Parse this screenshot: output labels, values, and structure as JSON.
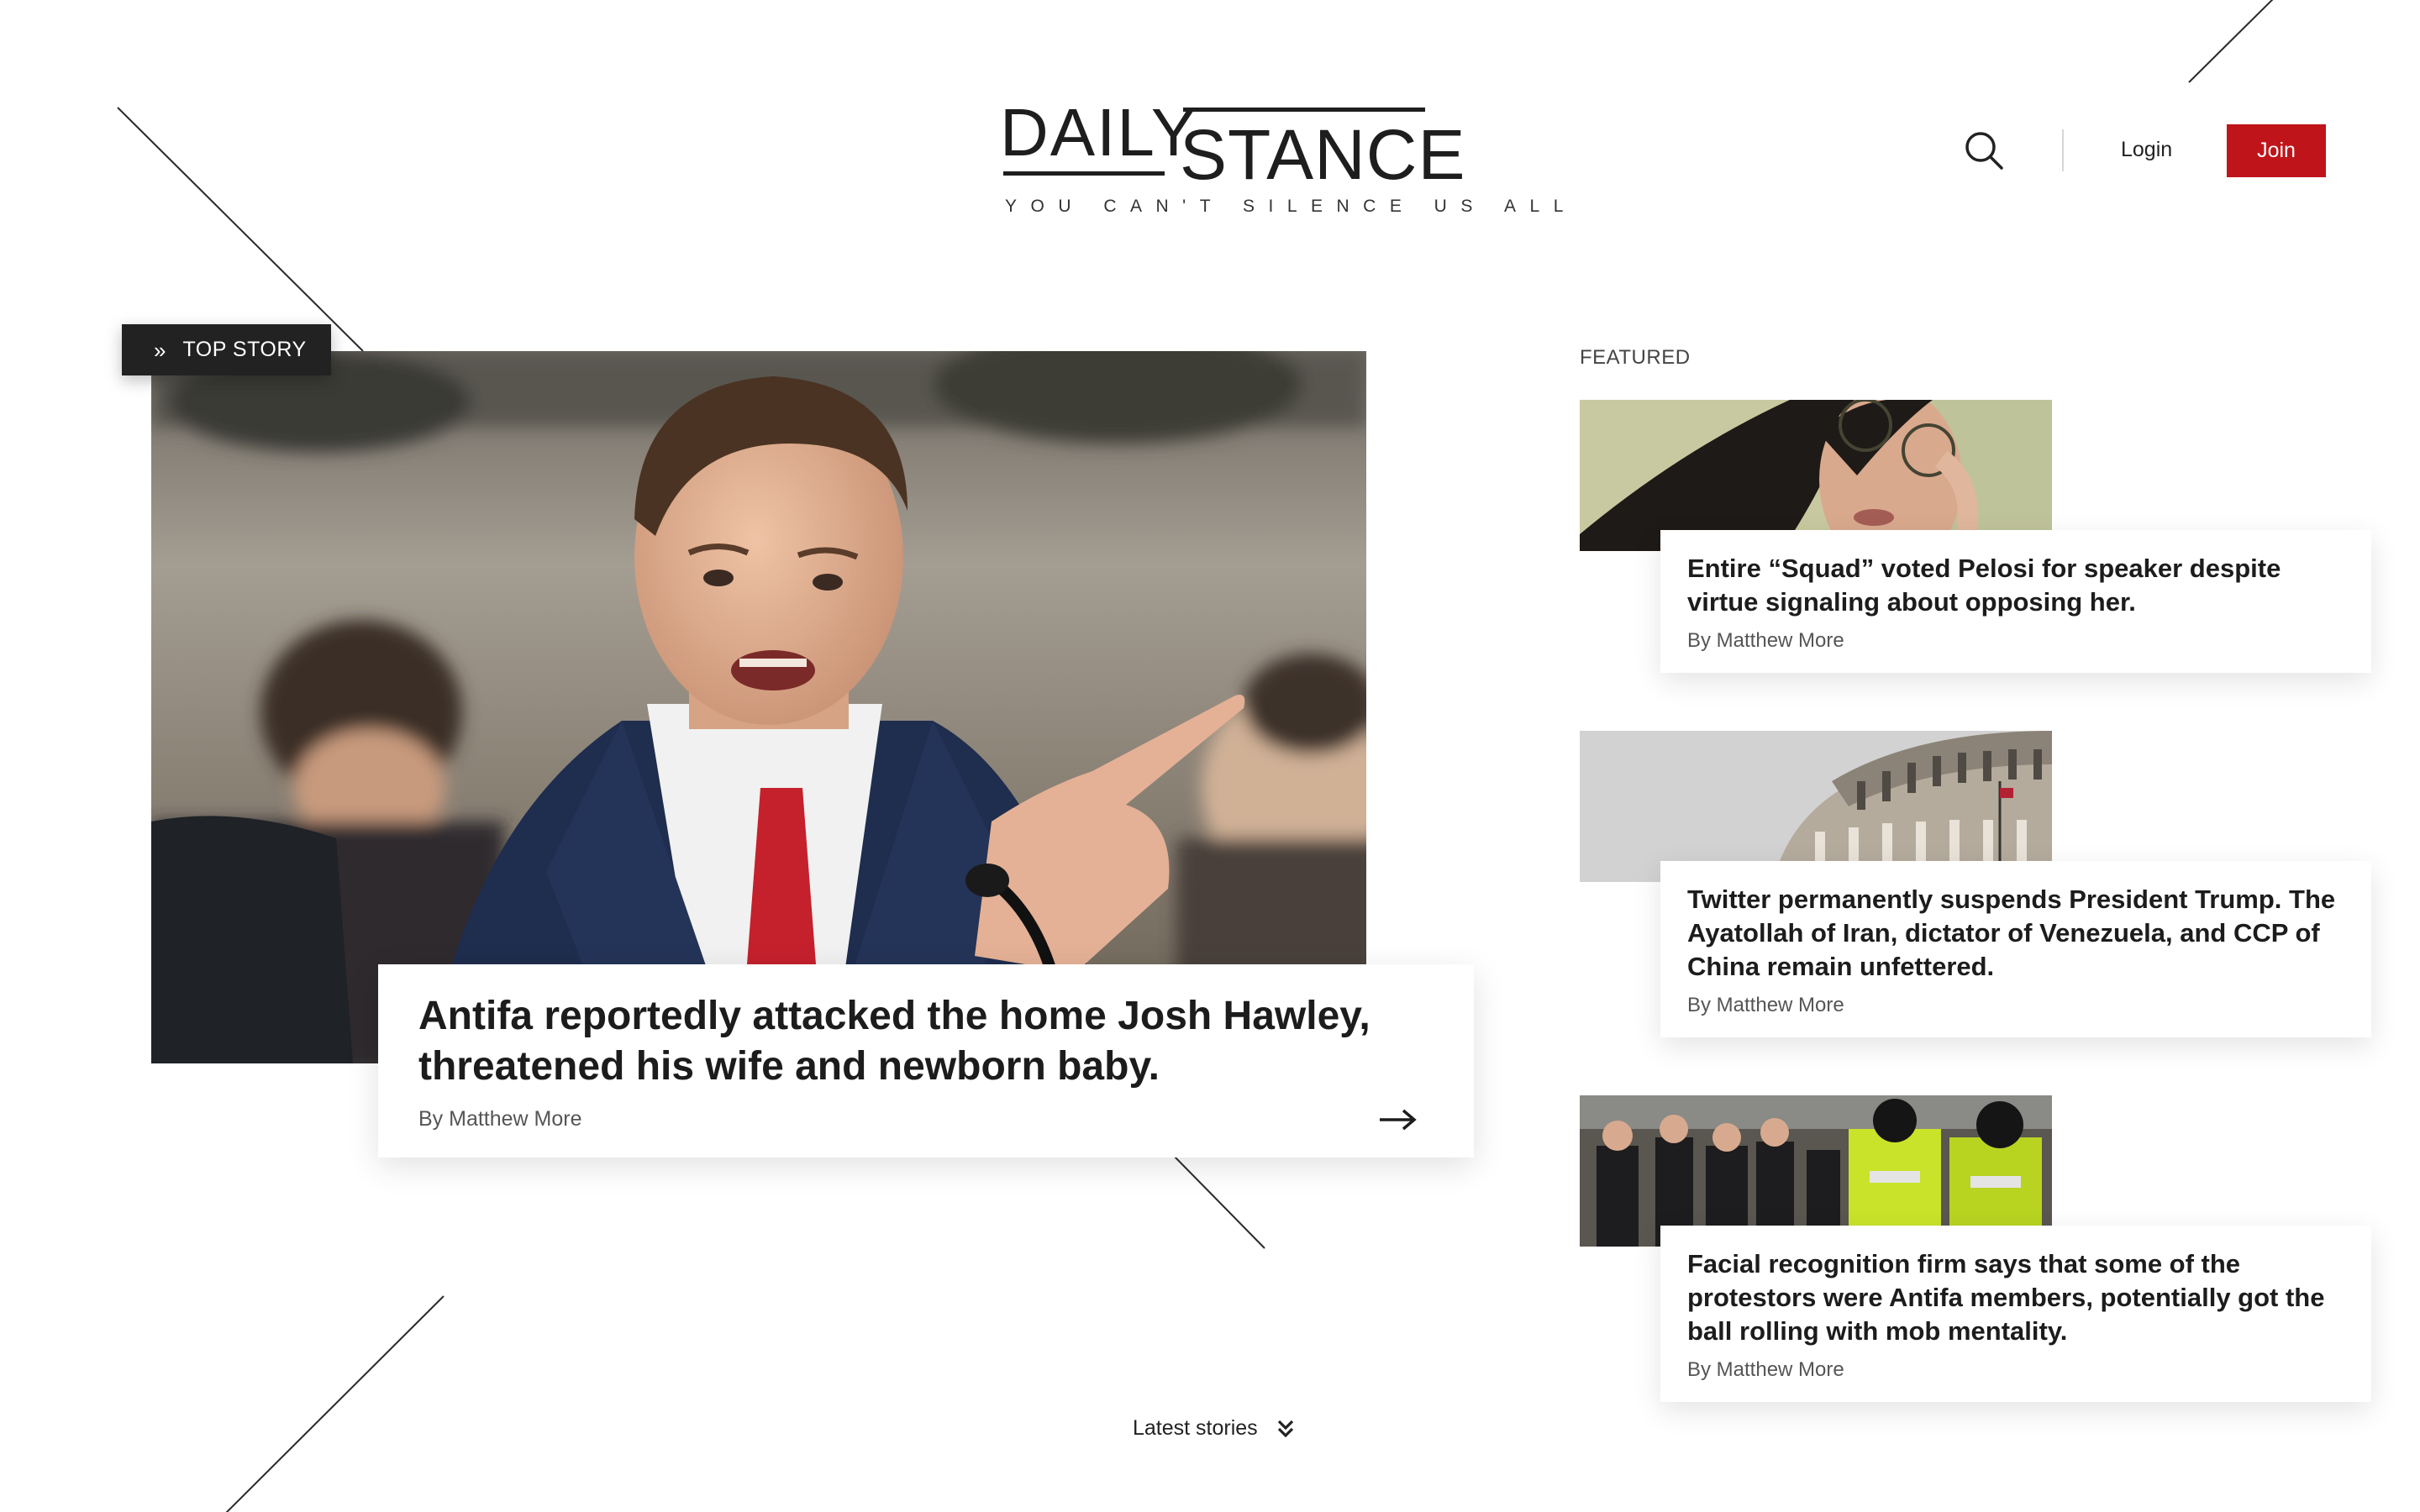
{
  "brand": {
    "name_line1": "DAILY",
    "name_line2": "STANCE",
    "tagline": "YOU CAN'T SILENCE US ALL"
  },
  "header": {
    "search_icon": "search-icon",
    "login_label": "Login",
    "join_label": "Join",
    "join_color": "#c0141b"
  },
  "top_story": {
    "badge_icon": "double-chevron-right-icon",
    "badge_label": "TOP STORY",
    "image": "photo of a man in a suit pointing at a hearing",
    "headline": "Antifa reportedly attacked the home Josh Hawley, threatened his wife and newborn baby.",
    "byline": "By Matthew More",
    "arrow_icon": "arrow-right-icon"
  },
  "featured": {
    "section_label": "FEATURED",
    "items": [
      {
        "image": "photo of a woman with glasses",
        "headline": "Entire “Squad” voted Pelosi for speaker despite virtue signaling about opposing her.",
        "byline": "By Matthew More"
      },
      {
        "image": "photo of the Capitol dome",
        "headline": "Twitter permanently suspends President Trump. The Ayatollah of Iran, dictator of Venezuela, and CCP of China remain unfettered.",
        "byline": "By Matthew More"
      },
      {
        "image": "photo of protestors and police",
        "headline": "Facial recognition firm says that some of the protestors were Antifa members, potentially got the ball rolling with mob mentality.",
        "byline": "By Matthew More"
      }
    ]
  },
  "footer": {
    "latest_label": "Latest stories",
    "latest_icon": "double-chevron-down-icon"
  },
  "colors": {
    "accent": "#c0141b",
    "text": "#1c1c1c",
    "badge_bg": "#222222"
  }
}
